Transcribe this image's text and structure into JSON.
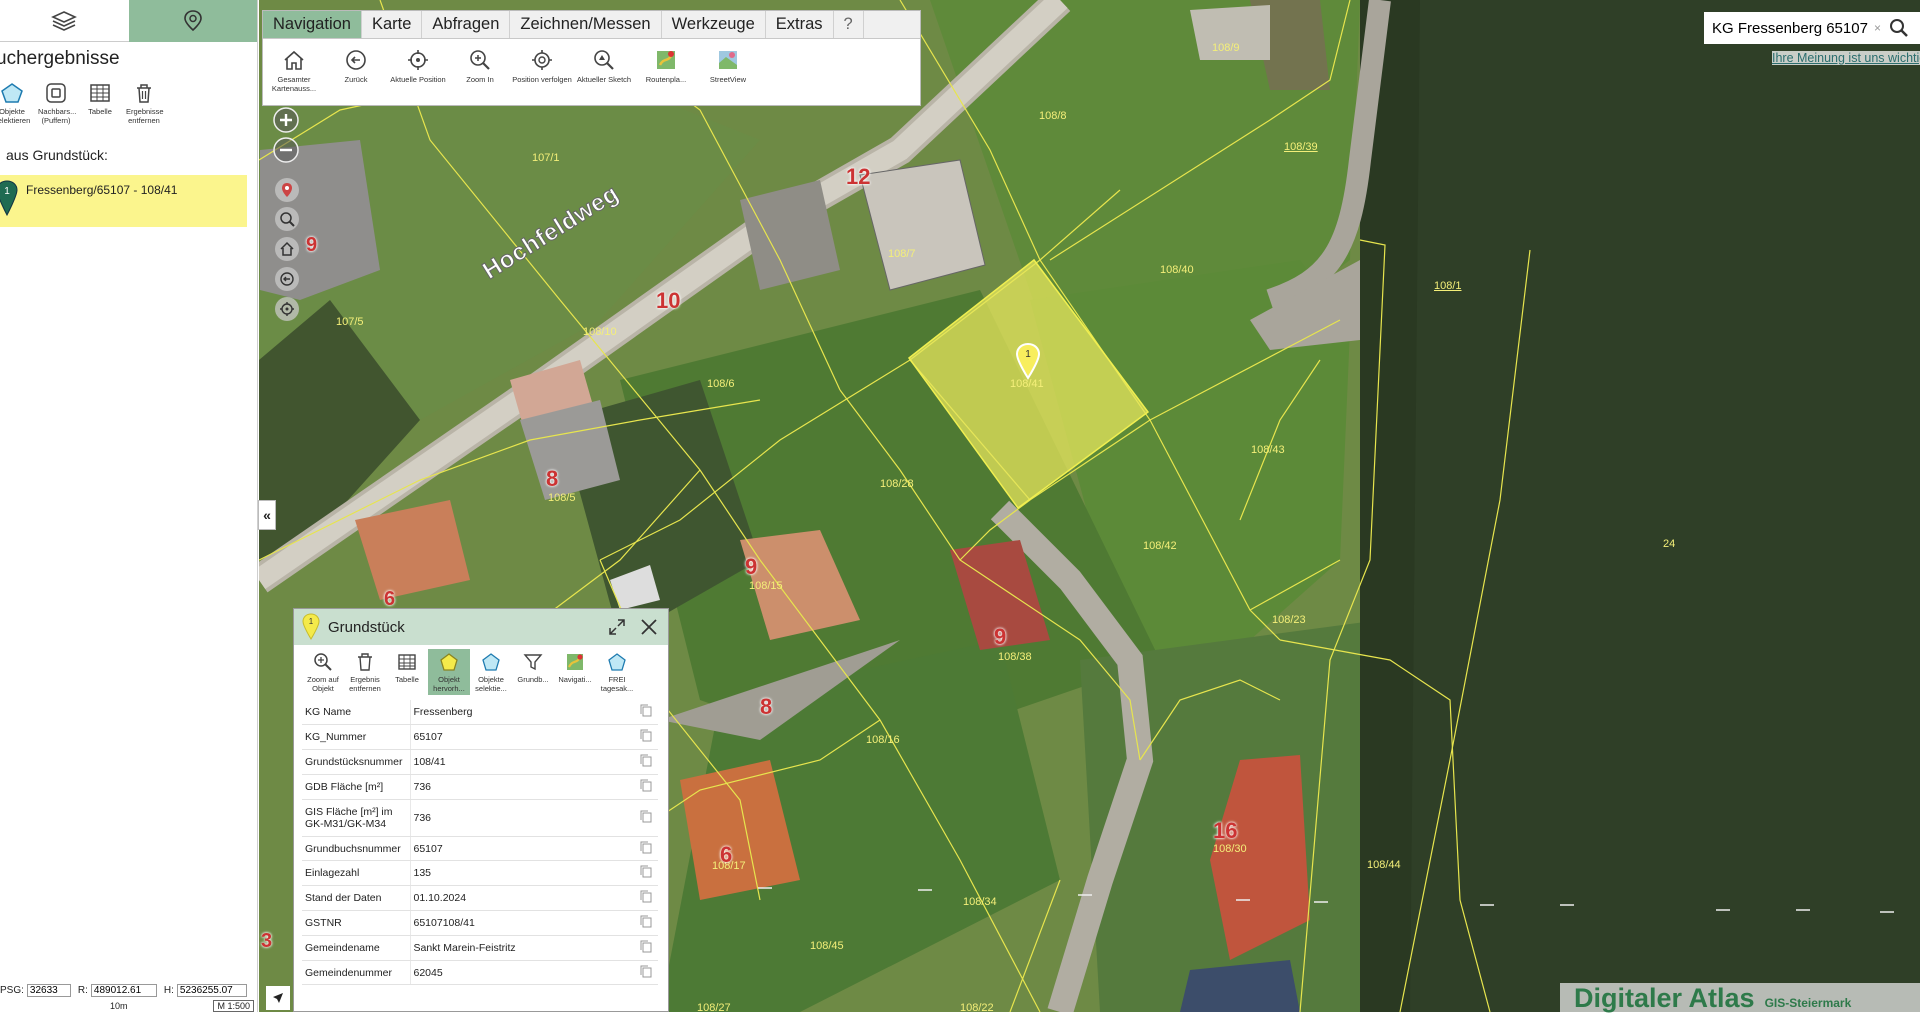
{
  "left_panel": {
    "title": "uchergebnisse",
    "tools": [
      {
        "label": "Objekte selektieren",
        "icon": "polygon-select-icon"
      },
      {
        "label": "Nachbars... (Puffern)",
        "icon": "buffer-icon"
      },
      {
        "label": "Tabelle",
        "icon": "table-icon"
      },
      {
        "label": "Ergebnisse entfernen",
        "icon": "trash-icon"
      }
    ],
    "section_title": "aus Grundstück:",
    "result": {
      "marker": "1",
      "text": "Fressenberg/65107 - 108/41"
    },
    "coords": {
      "label_psg": "PSG:",
      "psg": "32633",
      "label_r": "R:",
      "r": "489012.61",
      "label_h": "H:",
      "h": "5236255.07"
    },
    "scale": {
      "distance": "10m",
      "ratio": "M 1:500"
    }
  },
  "menu": {
    "tabs": [
      "Navigation",
      "Karte",
      "Abfragen",
      "Zeichnen/Messen",
      "Werkzeuge",
      "Extras",
      "?"
    ],
    "active_tab": "Navigation",
    "tools": [
      {
        "label": "Gesamter Kartenauss...",
        "icon": "home-icon"
      },
      {
        "label": "Zurück",
        "icon": "back-icon"
      },
      {
        "label": "Aktuelle Position",
        "icon": "crosshair-icon"
      },
      {
        "label": "Zoom In",
        "icon": "zoom-in-icon"
      },
      {
        "label": "Position verfolgen",
        "icon": "track-position-icon"
      },
      {
        "label": "Aktueller Sketch",
        "icon": "sketch-zoom-icon"
      },
      {
        "label": "Routenpla...",
        "icon": "route-planner-icon"
      },
      {
        "label": "StreetView",
        "icon": "streetview-icon"
      }
    ]
  },
  "search": {
    "value": "KG Fressenberg 65107",
    "clear": "×"
  },
  "feedback_link": "Ihre Meinung ist uns wichtig",
  "map": {
    "street": "Hochfeldweg",
    "selected_marker": "1",
    "parcels": [
      {
        "id": "p-107-1",
        "label": "107/1"
      },
      {
        "id": "p-107-5",
        "label": "107/5"
      },
      {
        "id": "p-108-10",
        "label": "108/10"
      },
      {
        "id": "p-108-6",
        "label": "108/6"
      },
      {
        "id": "p-108-5",
        "label": "108/5"
      },
      {
        "id": "p-108-8",
        "label": "108/8"
      },
      {
        "id": "p-108-7",
        "label": "108/7"
      },
      {
        "id": "p-108-39",
        "label": "108/39"
      },
      {
        "id": "p-108-9",
        "label": "108/9"
      },
      {
        "id": "p-108-40",
        "label": "108/40"
      },
      {
        "id": "p-108-41",
        "label": "108/41"
      },
      {
        "id": "p-108-28",
        "label": "108/28"
      },
      {
        "id": "p-108-43",
        "label": "108/43"
      },
      {
        "id": "p-108-42",
        "label": "108/42"
      },
      {
        "id": "p-108-1",
        "label": "108/1"
      },
      {
        "id": "p-24",
        "label": "24"
      },
      {
        "id": "p-108-15",
        "label": "108/15"
      },
      {
        "id": "p-108-38",
        "label": "108/38"
      },
      {
        "id": "p-108-23",
        "label": "108/23"
      },
      {
        "id": "p-108-16",
        "label": "108/16"
      },
      {
        "id": "p-108-30",
        "label": "108/30"
      },
      {
        "id": "p-108-44",
        "label": "108/44"
      },
      {
        "id": "p-108-34",
        "label": "108/34"
      },
      {
        "id": "p-108-17",
        "label": "108/17"
      },
      {
        "id": "p-108-45",
        "label": "108/45"
      },
      {
        "id": "p-108-27",
        "label": "108/27"
      },
      {
        "id": "p-108-22",
        "label": "108/22"
      }
    ],
    "house_numbers": [
      "12",
      "9",
      "10",
      "8",
      "6",
      "9",
      "9",
      "8",
      "16",
      "6",
      "3"
    ]
  },
  "watermark": {
    "big": "Digitaler Atlas",
    "small": "GIS-Steiermark"
  },
  "popup": {
    "title": "Grundstück",
    "marker": "1",
    "tools": [
      {
        "label": "Zoom auf Objekt",
        "icon": "zoom-object-icon"
      },
      {
        "label": "Ergebnis entfernen",
        "icon": "trash-icon"
      },
      {
        "label": "Tabelle",
        "icon": "table-icon"
      },
      {
        "label": "Objekt hervorh...",
        "icon": "highlight-object-icon"
      },
      {
        "label": "Objekte selektie...",
        "icon": "polygon-select-icon"
      },
      {
        "label": "Grundb...",
        "icon": "filter-icon"
      },
      {
        "label": "Navigati...",
        "icon": "route-planner-icon"
      },
      {
        "label": "FREI tagesak...",
        "icon": "polygon-icon"
      }
    ],
    "rows": [
      {
        "key": "KG Name",
        "value": "Fressenberg"
      },
      {
        "key": "KG_Nummer",
        "value": "65107"
      },
      {
        "key": "Grundstücksnummer",
        "value": "108/41"
      },
      {
        "key": "GDB Fläche [m²]",
        "value": "736"
      },
      {
        "key": "GIS Fläche [m²] im GK-M31/GK-M34",
        "value": "736"
      },
      {
        "key": "Grundbuchsnummer",
        "value": "65107"
      },
      {
        "key": "Einlagezahl",
        "value": "135"
      },
      {
        "key": "Stand der Daten",
        "value": "01.10.2024"
      },
      {
        "key": "GSTNR",
        "value": "65107108/41"
      },
      {
        "key": "Gemeindename",
        "value": "Sankt Marein-Feistritz"
      },
      {
        "key": "Gemeindenummer",
        "value": "62045"
      }
    ]
  }
}
